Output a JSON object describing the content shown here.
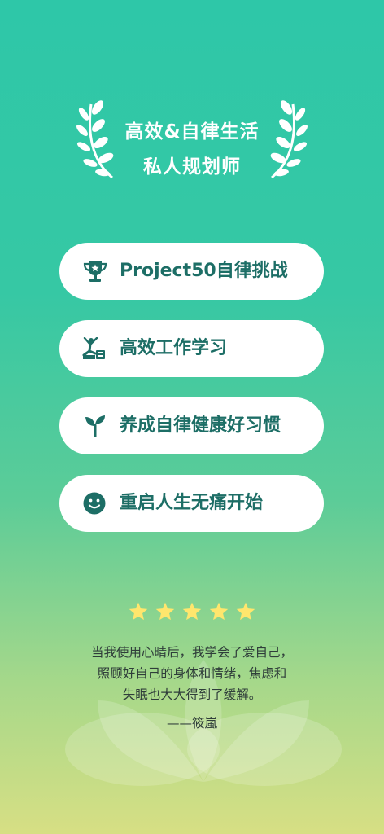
{
  "header": {
    "title_line1": "高效&自律生活",
    "title_line2": "私人规划师"
  },
  "options": [
    {
      "label": "Project50自律挑战",
      "icon": "trophy-icon"
    },
    {
      "label": "高效工作学习",
      "icon": "yoga-person-icon"
    },
    {
      "label": "养成自律健康好习惯",
      "icon": "sprout-icon"
    },
    {
      "label": "重启人生无痛开始",
      "icon": "smiley-icon"
    }
  ],
  "review": {
    "rating": 5,
    "line1": "当我使用心晴后，我学会了爱自己，",
    "line2": "照顾好自己的身体和情绪，焦虑和",
    "line3": "失眠也大大得到了缓解。",
    "author": "——筱嵐"
  },
  "colors": {
    "accent": "#1d6e66",
    "star": "#ffe66d",
    "bg_top": "#2ec7a8",
    "bg_bottom": "#d7df84"
  }
}
